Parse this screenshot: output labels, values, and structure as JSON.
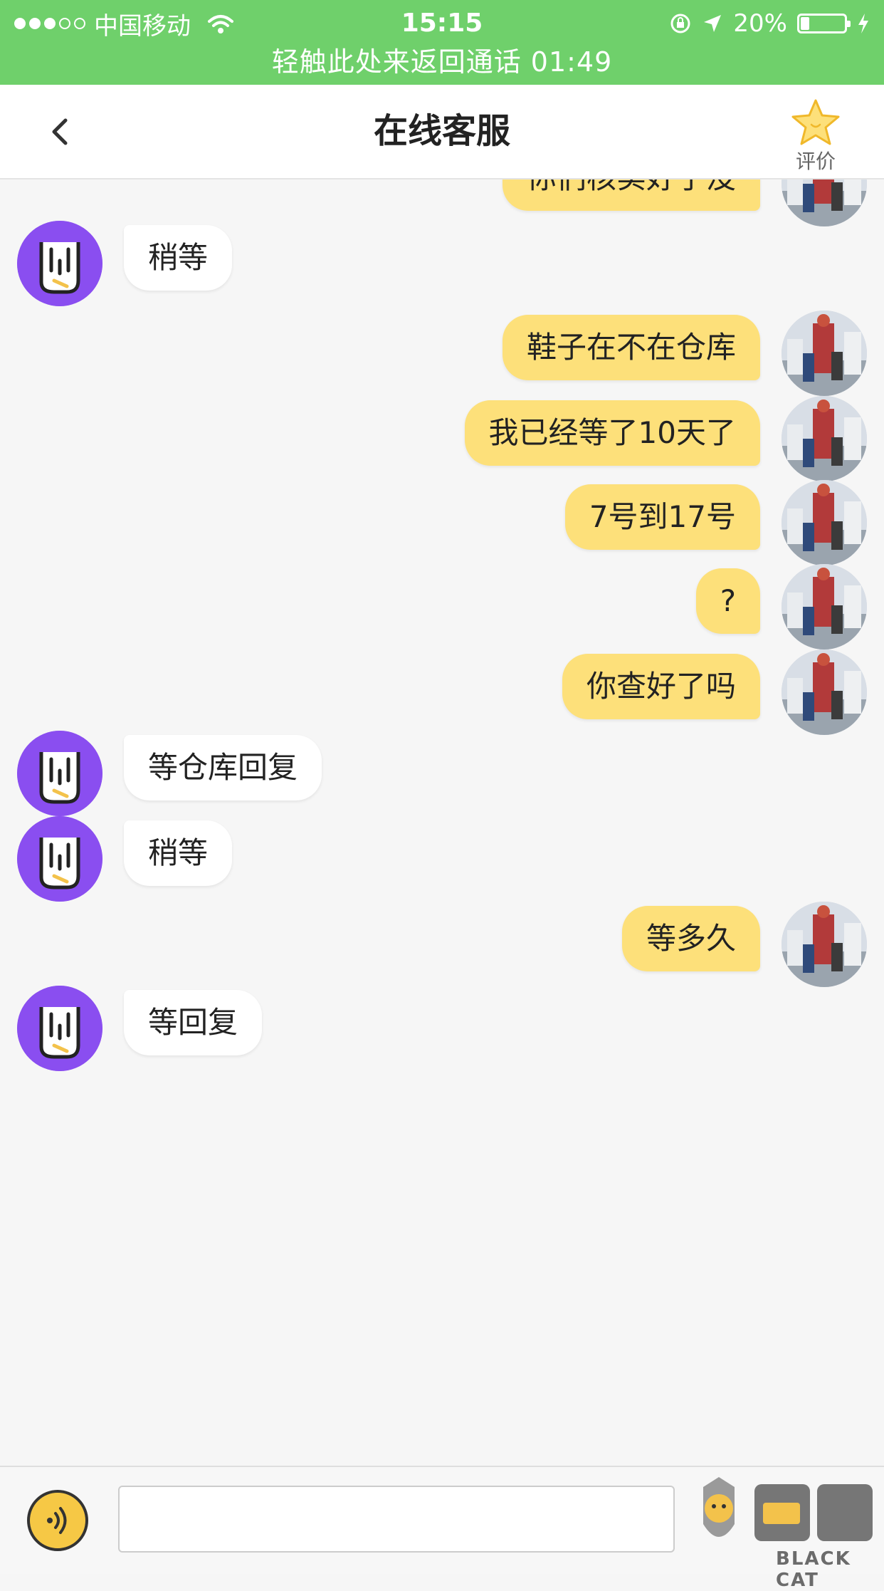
{
  "status_bar": {
    "carrier": "中国移动",
    "time": "15:15",
    "battery": "20%",
    "battery_level": 0.2,
    "call_banner": "轻触此处来返回通话 01:49"
  },
  "nav": {
    "title": "在线客服",
    "rate_label": "评价"
  },
  "messages": [
    {
      "from": "user",
      "text": "你们核实好了没"
    },
    {
      "from": "agent",
      "text": "稍等"
    },
    {
      "from": "user",
      "text": "鞋子在不在仓库"
    },
    {
      "from": "user",
      "text": "我已经等了10天了"
    },
    {
      "from": "user",
      "text": "7号到17号"
    },
    {
      "from": "user",
      "text": "?"
    },
    {
      "from": "user",
      "text": "你查好了吗"
    },
    {
      "from": "agent",
      "text": "等仓库回复"
    },
    {
      "from": "agent",
      "text": "稍等"
    },
    {
      "from": "user",
      "text": "等多久"
    },
    {
      "from": "agent",
      "text": "等回复"
    }
  ],
  "input": {
    "placeholder": ""
  },
  "watermark": {
    "text": "BLACK CAT"
  },
  "colors": {
    "status_bar": "#6fd06b",
    "user_bubble": "#fde07a",
    "agent_bubble": "#ffffff",
    "agent_avatar": "#8a4ef0",
    "rate_star": "#f6c845"
  }
}
